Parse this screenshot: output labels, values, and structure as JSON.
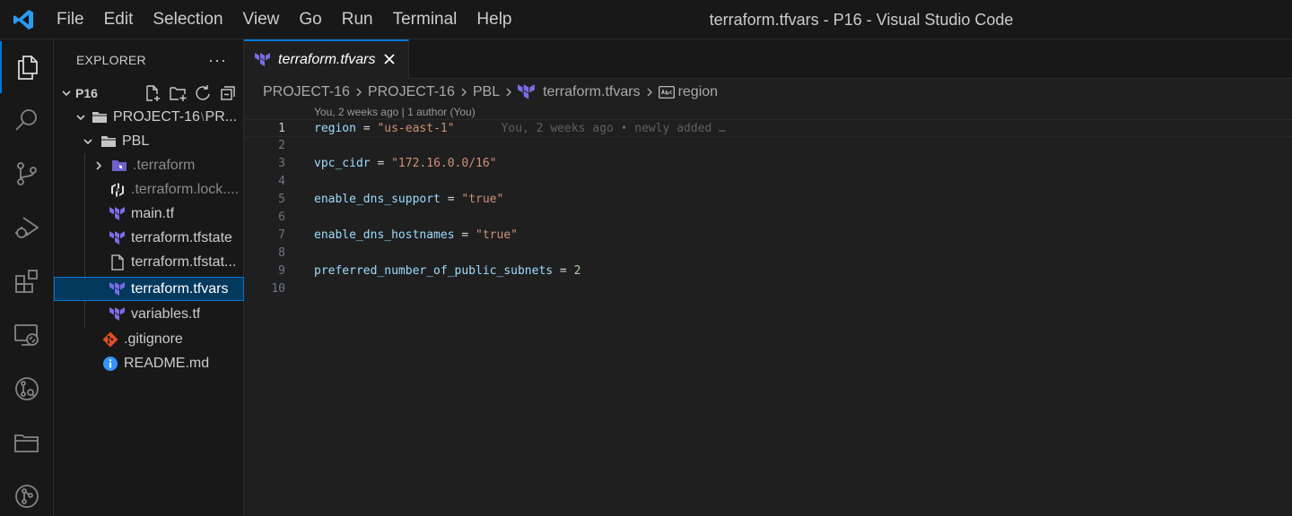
{
  "window": {
    "title": "terraform.tfvars - P16 - Visual Studio Code"
  },
  "menu": [
    "File",
    "Edit",
    "Selection",
    "View",
    "Go",
    "Run",
    "Terminal",
    "Help"
  ],
  "activity_bar": [
    {
      "name": "explorer-icon",
      "active": true
    },
    {
      "name": "search-icon"
    },
    {
      "name": "source-control-icon"
    },
    {
      "name": "run-debug-icon"
    },
    {
      "name": "extensions-icon"
    },
    {
      "name": "remote-explorer-icon"
    },
    {
      "name": "gitlens-icon"
    },
    {
      "name": "folders-icon"
    },
    {
      "name": "git-graph-icon"
    }
  ],
  "sidebar": {
    "title": "EXPLORER",
    "more": "···",
    "root": "P16",
    "project_prefix": "PROJECT-16",
    "project_sep": "\\",
    "project_suffix": "PR...",
    "pbl": "PBL",
    "items": [
      {
        "label": ".terraform",
        "dim": true
      },
      {
        "label": ".terraform.lock....",
        "dim": true
      },
      {
        "label": "main.tf"
      },
      {
        "label": "terraform.tfstate"
      },
      {
        "label": "terraform.tfstat..."
      },
      {
        "label": "terraform.tfvars",
        "selected": true
      },
      {
        "label": "variables.tf"
      }
    ],
    "root_files": [
      {
        "label": ".gitignore"
      },
      {
        "label": "README.md"
      }
    ]
  },
  "editor": {
    "tab": {
      "label": "terraform.tfvars"
    },
    "breadcrumb": [
      "PROJECT-16",
      "PROJECT-16",
      "PBL",
      "terraform.tfvars",
      "region"
    ],
    "blame_header": "You, 2 weeks ago | 1 author (You)",
    "inline_blame": "You, 2 weeks ago • newly added …",
    "line_numbers": [
      "1",
      "2",
      "3",
      "4",
      "5",
      "6",
      "7",
      "8",
      "9",
      "10"
    ],
    "lines": [
      {
        "key": "region",
        "op": " = ",
        "str": "\"us-east-1\""
      },
      {
        "key": "vpc_cidr",
        "op": " = ",
        "str": "\"172.16.0.0/16\""
      },
      {
        "key": "enable_dns_support",
        "op": " = ",
        "str": "\"true\""
      },
      {
        "key": "enable_dns_hostnames",
        "op": " = ",
        "str": "\"true\""
      },
      {
        "key": "preferred_number_of_public_subnets",
        "op": " = ",
        "num": "2"
      }
    ]
  },
  "colors": {
    "accent": "#0078d4",
    "terraform": "#7b6ce6",
    "git": "#e44d26",
    "info": "#3794ff"
  }
}
